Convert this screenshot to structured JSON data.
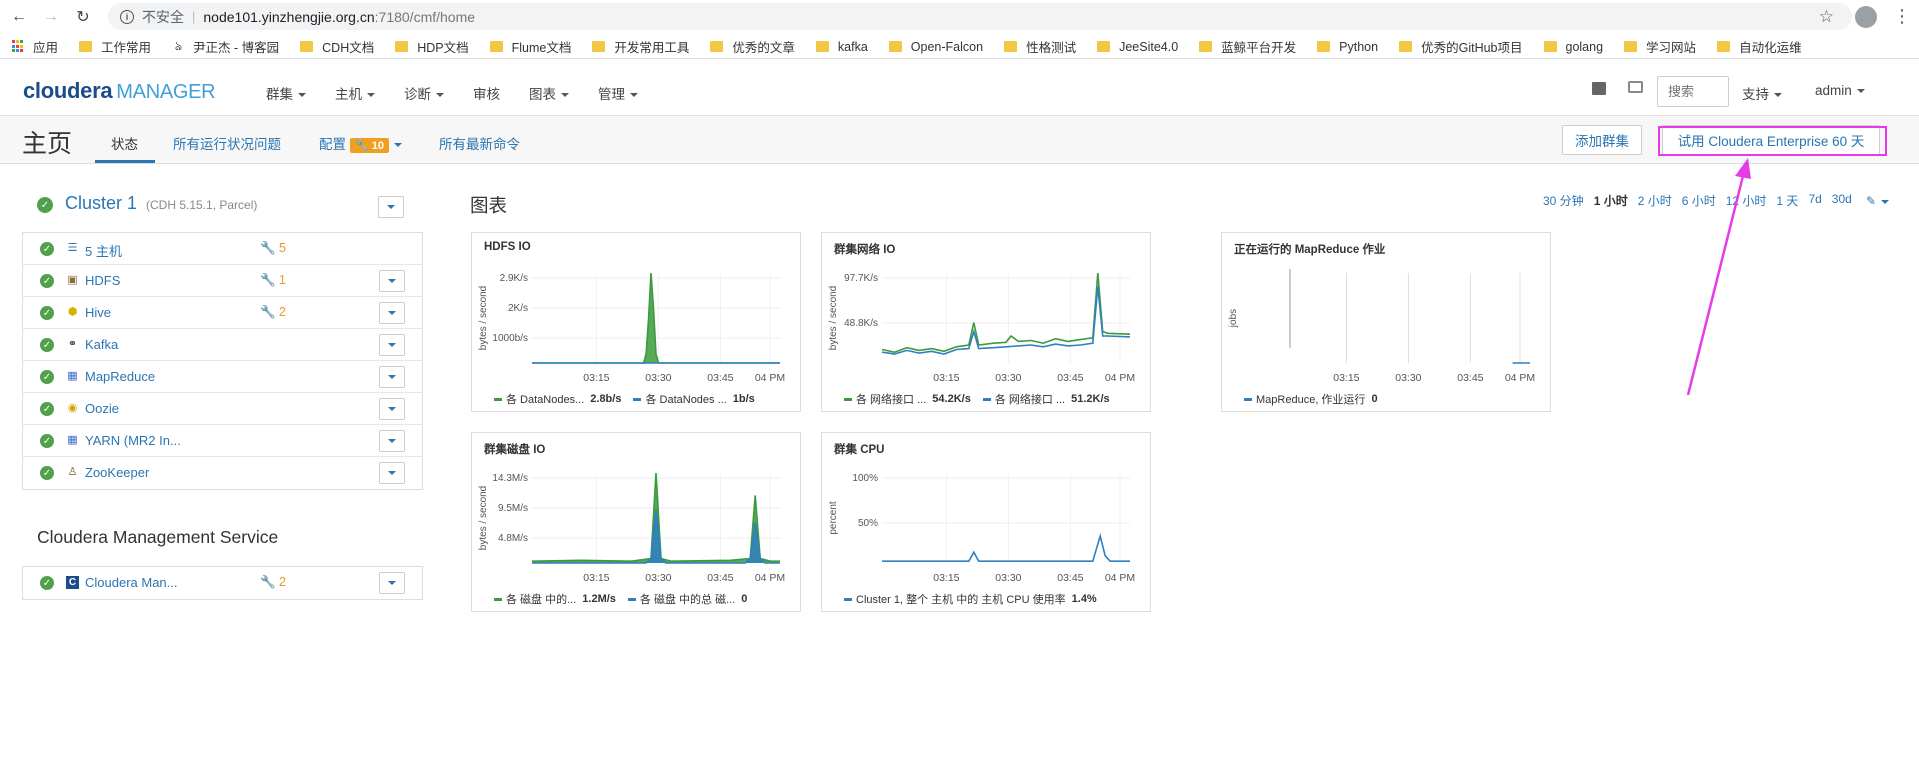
{
  "browser": {
    "insecure_label": "不安全",
    "url_host": "node101.yinzhengjie.org.cn",
    "url_path": ":7180/cmf/home"
  },
  "bookmarks": [
    "应用",
    "工作常用",
    "尹正杰 - 博客园",
    "CDH文档",
    "HDP文档",
    "Flume文档",
    "开发常用工具",
    "优秀的文章",
    "kafka",
    "Open-Falcon",
    "性格测试",
    "JeeSite4.0",
    "蓝鲸平台开发",
    "Python",
    "优秀的GitHub项目",
    "golang",
    "学习网站",
    "自动化运维"
  ],
  "app": {
    "logo_cloudera": "cloudera",
    "logo_manager": "MANAGER",
    "nav": [
      "群集",
      "主机",
      "诊断",
      "审核",
      "图表",
      "管理"
    ],
    "search_placeholder": "搜索",
    "support": "支持",
    "admin": "admin"
  },
  "page": {
    "title": "主页",
    "tabs": {
      "status": "状态",
      "health": "所有运行状况问题",
      "config": "配置",
      "config_badge": "10",
      "commands": "所有最新命令"
    },
    "add_cluster": "添加群集",
    "trial": "试用 Cloudera Enterprise 60 天"
  },
  "cluster": {
    "name": "Cluster 1",
    "sub": "(CDH 5.15.1, Parcel)",
    "services": [
      {
        "name": "5 主机",
        "icon": "list-icon",
        "warn": "5"
      },
      {
        "name": "HDFS",
        "icon": "hdfs-icon",
        "warn": "1"
      },
      {
        "name": "Hive",
        "icon": "hive-icon",
        "warn": "2"
      },
      {
        "name": "Kafka",
        "icon": "kafka-icon",
        "warn": ""
      },
      {
        "name": "MapReduce",
        "icon": "mapreduce-icon",
        "warn": ""
      },
      {
        "name": "Oozie",
        "icon": "oozie-icon",
        "warn": ""
      },
      {
        "name": "YARN (MR2 In...",
        "icon": "yarn-icon",
        "warn": ""
      },
      {
        "name": "ZooKeeper",
        "icon": "zookeeper-icon",
        "warn": ""
      }
    ]
  },
  "mgmt": {
    "title": "Cloudera Management Service",
    "service": {
      "name": "Cloudera Man...",
      "warn": "2"
    }
  },
  "charts": {
    "title": "图表",
    "ranges": [
      "30 分钟",
      "1 小时",
      "2 小时",
      "6 小时",
      "12 小时",
      "1 天",
      "7d",
      "30d"
    ],
    "selected_range": "1 小时"
  },
  "colors": {
    "green": "#3c9a3c",
    "blue": "#2f7fc1",
    "accent": "#2a75b3",
    "warn": "#e89a2a",
    "annotation": "#e83be8"
  },
  "chart_data": [
    {
      "type": "area",
      "title": "HDFS IO",
      "ylabel": "bytes / second",
      "yticks": [
        "2.9K/s",
        "2K/s",
        "1000b/s"
      ],
      "xticks": [
        "03:15",
        "03:30",
        "03:45",
        "04 PM"
      ],
      "series": [
        {
          "name": "各 DataNodes...",
          "value": "2.8b/s",
          "color": "#3c9a3c",
          "x": [
            0,
            0.45,
            0.46,
            0.47,
            0.48,
            0.49,
            0.5,
            0.51,
            1
          ],
          "y": [
            0,
            0,
            0.1,
            0.5,
            1.0,
            0.6,
            0.1,
            0,
            0
          ]
        },
        {
          "name": "各 DataNodes ...",
          "value": "1b/s",
          "color": "#2f7fc1",
          "x": [
            0,
            1
          ],
          "y": [
            0,
            0
          ]
        }
      ]
    },
    {
      "type": "line",
      "title": "群集网络 IO",
      "ylabel": "bytes / second",
      "yticks": [
        "97.7K/s",
        "48.8K/s"
      ],
      "xticks": [
        "03:15",
        "03:30",
        "03:45",
        "04 PM"
      ],
      "series": [
        {
          "name": "各 网络接口 ...",
          "value": "54.2K/s",
          "color": "#3c9a3c",
          "x": [
            0,
            0.05,
            0.1,
            0.15,
            0.2,
            0.25,
            0.3,
            0.35,
            0.37,
            0.39,
            0.45,
            0.5,
            0.52,
            0.55,
            0.6,
            0.65,
            0.7,
            0.75,
            0.8,
            0.85,
            0.87,
            0.89,
            0.91,
            1
          ],
          "y": [
            0.15,
            0.12,
            0.17,
            0.14,
            0.16,
            0.13,
            0.18,
            0.2,
            0.45,
            0.2,
            0.22,
            0.23,
            0.3,
            0.24,
            0.25,
            0.22,
            0.27,
            0.24,
            0.26,
            0.28,
            1.0,
            0.35,
            0.33,
            0.32
          ]
        },
        {
          "name": "各 网络接口 ...",
          "value": "51.2K/s",
          "color": "#2f7fc1",
          "x": [
            0,
            0.05,
            0.1,
            0.15,
            0.2,
            0.25,
            0.3,
            0.35,
            0.37,
            0.39,
            0.45,
            0.5,
            0.55,
            0.6,
            0.65,
            0.7,
            0.75,
            0.8,
            0.85,
            0.87,
            0.89,
            0.91,
            1
          ],
          "y": [
            0.12,
            0.1,
            0.14,
            0.11,
            0.13,
            0.1,
            0.15,
            0.16,
            0.35,
            0.16,
            0.17,
            0.18,
            0.19,
            0.2,
            0.18,
            0.21,
            0.19,
            0.2,
            0.22,
            0.85,
            0.3,
            0.3,
            0.29
          ]
        }
      ]
    },
    {
      "type": "line",
      "title": "正在运行的 MapReduce 作业",
      "ylabel": "jobs",
      "yticks": [],
      "xticks": [
        "03:15",
        "03:30",
        "03:45",
        "04 PM"
      ],
      "series": [
        {
          "name": "MapReduce, 作业运行",
          "value": "0",
          "color": "#2f7fc1",
          "x": [
            0.93,
            1
          ],
          "y": [
            0,
            0
          ]
        }
      ]
    },
    {
      "type": "area",
      "title": "群集磁盘 IO",
      "ylabel": "bytes / second",
      "yticks": [
        "14.3M/s",
        "9.5M/s",
        "4.8M/s"
      ],
      "xticks": [
        "03:15",
        "03:30",
        "03:45",
        "04 PM"
      ],
      "series": [
        {
          "name": "各 磁盘 中的...",
          "value": "1.2M/s",
          "color": "#3c9a3c",
          "x": [
            0,
            0.2,
            0.4,
            0.48,
            0.5,
            0.52,
            0.56,
            0.8,
            0.88,
            0.9,
            0.92,
            0.96,
            1
          ],
          "y": [
            0.02,
            0.03,
            0.02,
            0.05,
            1.0,
            0.05,
            0.02,
            0.03,
            0.05,
            0.75,
            0.05,
            0.02,
            0.02
          ]
        },
        {
          "name": "各 磁盘 中的总 磁...",
          "value": "0",
          "color": "#2f7fc1",
          "x": [
            0,
            0.46,
            0.48,
            0.5,
            0.52,
            0.54,
            0.86,
            0.88,
            0.9,
            0.92,
            0.94,
            1
          ],
          "y": [
            0,
            0,
            0.05,
            0.6,
            0.05,
            0,
            0,
            0.05,
            0.45,
            0.05,
            0,
            0
          ]
        }
      ]
    },
    {
      "type": "line",
      "title": "群集 CPU",
      "ylabel": "percent",
      "yticks": [
        "100%",
        "50%"
      ],
      "xticks": [
        "03:15",
        "03:30",
        "03:45",
        "04 PM"
      ],
      "series": [
        {
          "name": "Cluster 1, 整个 主机 中的 主机 CPU 使用率",
          "value": "1.4%",
          "color": "#2f7fc1",
          "x": [
            0,
            0.3,
            0.35,
            0.37,
            0.39,
            0.6,
            0.85,
            0.88,
            0.9,
            0.92,
            1
          ],
          "y": [
            0.02,
            0.02,
            0.02,
            0.12,
            0.02,
            0.02,
            0.02,
            0.3,
            0.08,
            0.02,
            0.02
          ]
        }
      ]
    }
  ]
}
